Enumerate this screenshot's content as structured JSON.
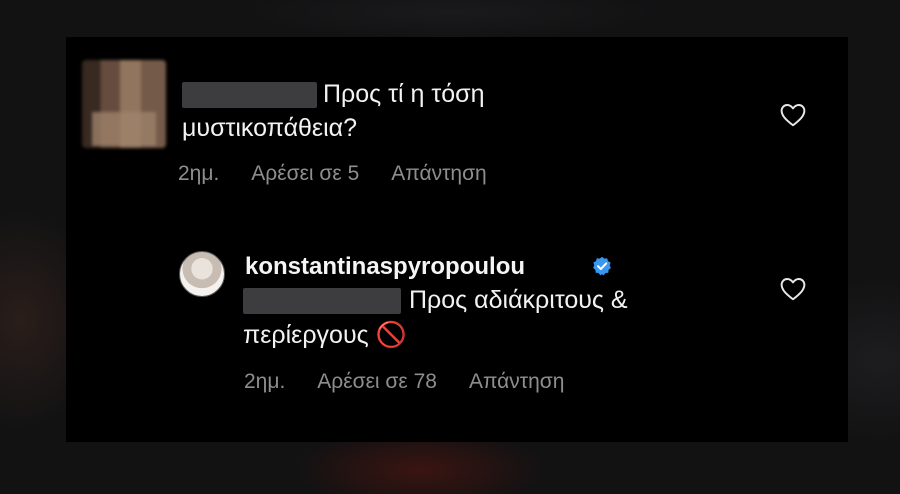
{
  "comment1": {
    "text_line1": "Προς τί η τόση",
    "text_line2": "μυστικοπάθεια?",
    "time": "2ημ.",
    "likes": "Αρέσει σε 5",
    "reply": "Απάντηση"
  },
  "comment2": {
    "username": "konstantinaspyropoulou",
    "text_line1": "Προς αδιάκριτους &",
    "text_line2": "περίεργους 🚫",
    "time": "2ημ.",
    "likes": "Αρέσει σε 78",
    "reply": "Απάντηση"
  },
  "icons": {
    "like": "heart-icon",
    "verified": "verified-badge-icon",
    "prohibited": "prohibited-emoji"
  },
  "colors": {
    "background": "#000000",
    "text": "#f2f2f2",
    "meta": "#8e8e8e",
    "verified": "#3897f0"
  }
}
